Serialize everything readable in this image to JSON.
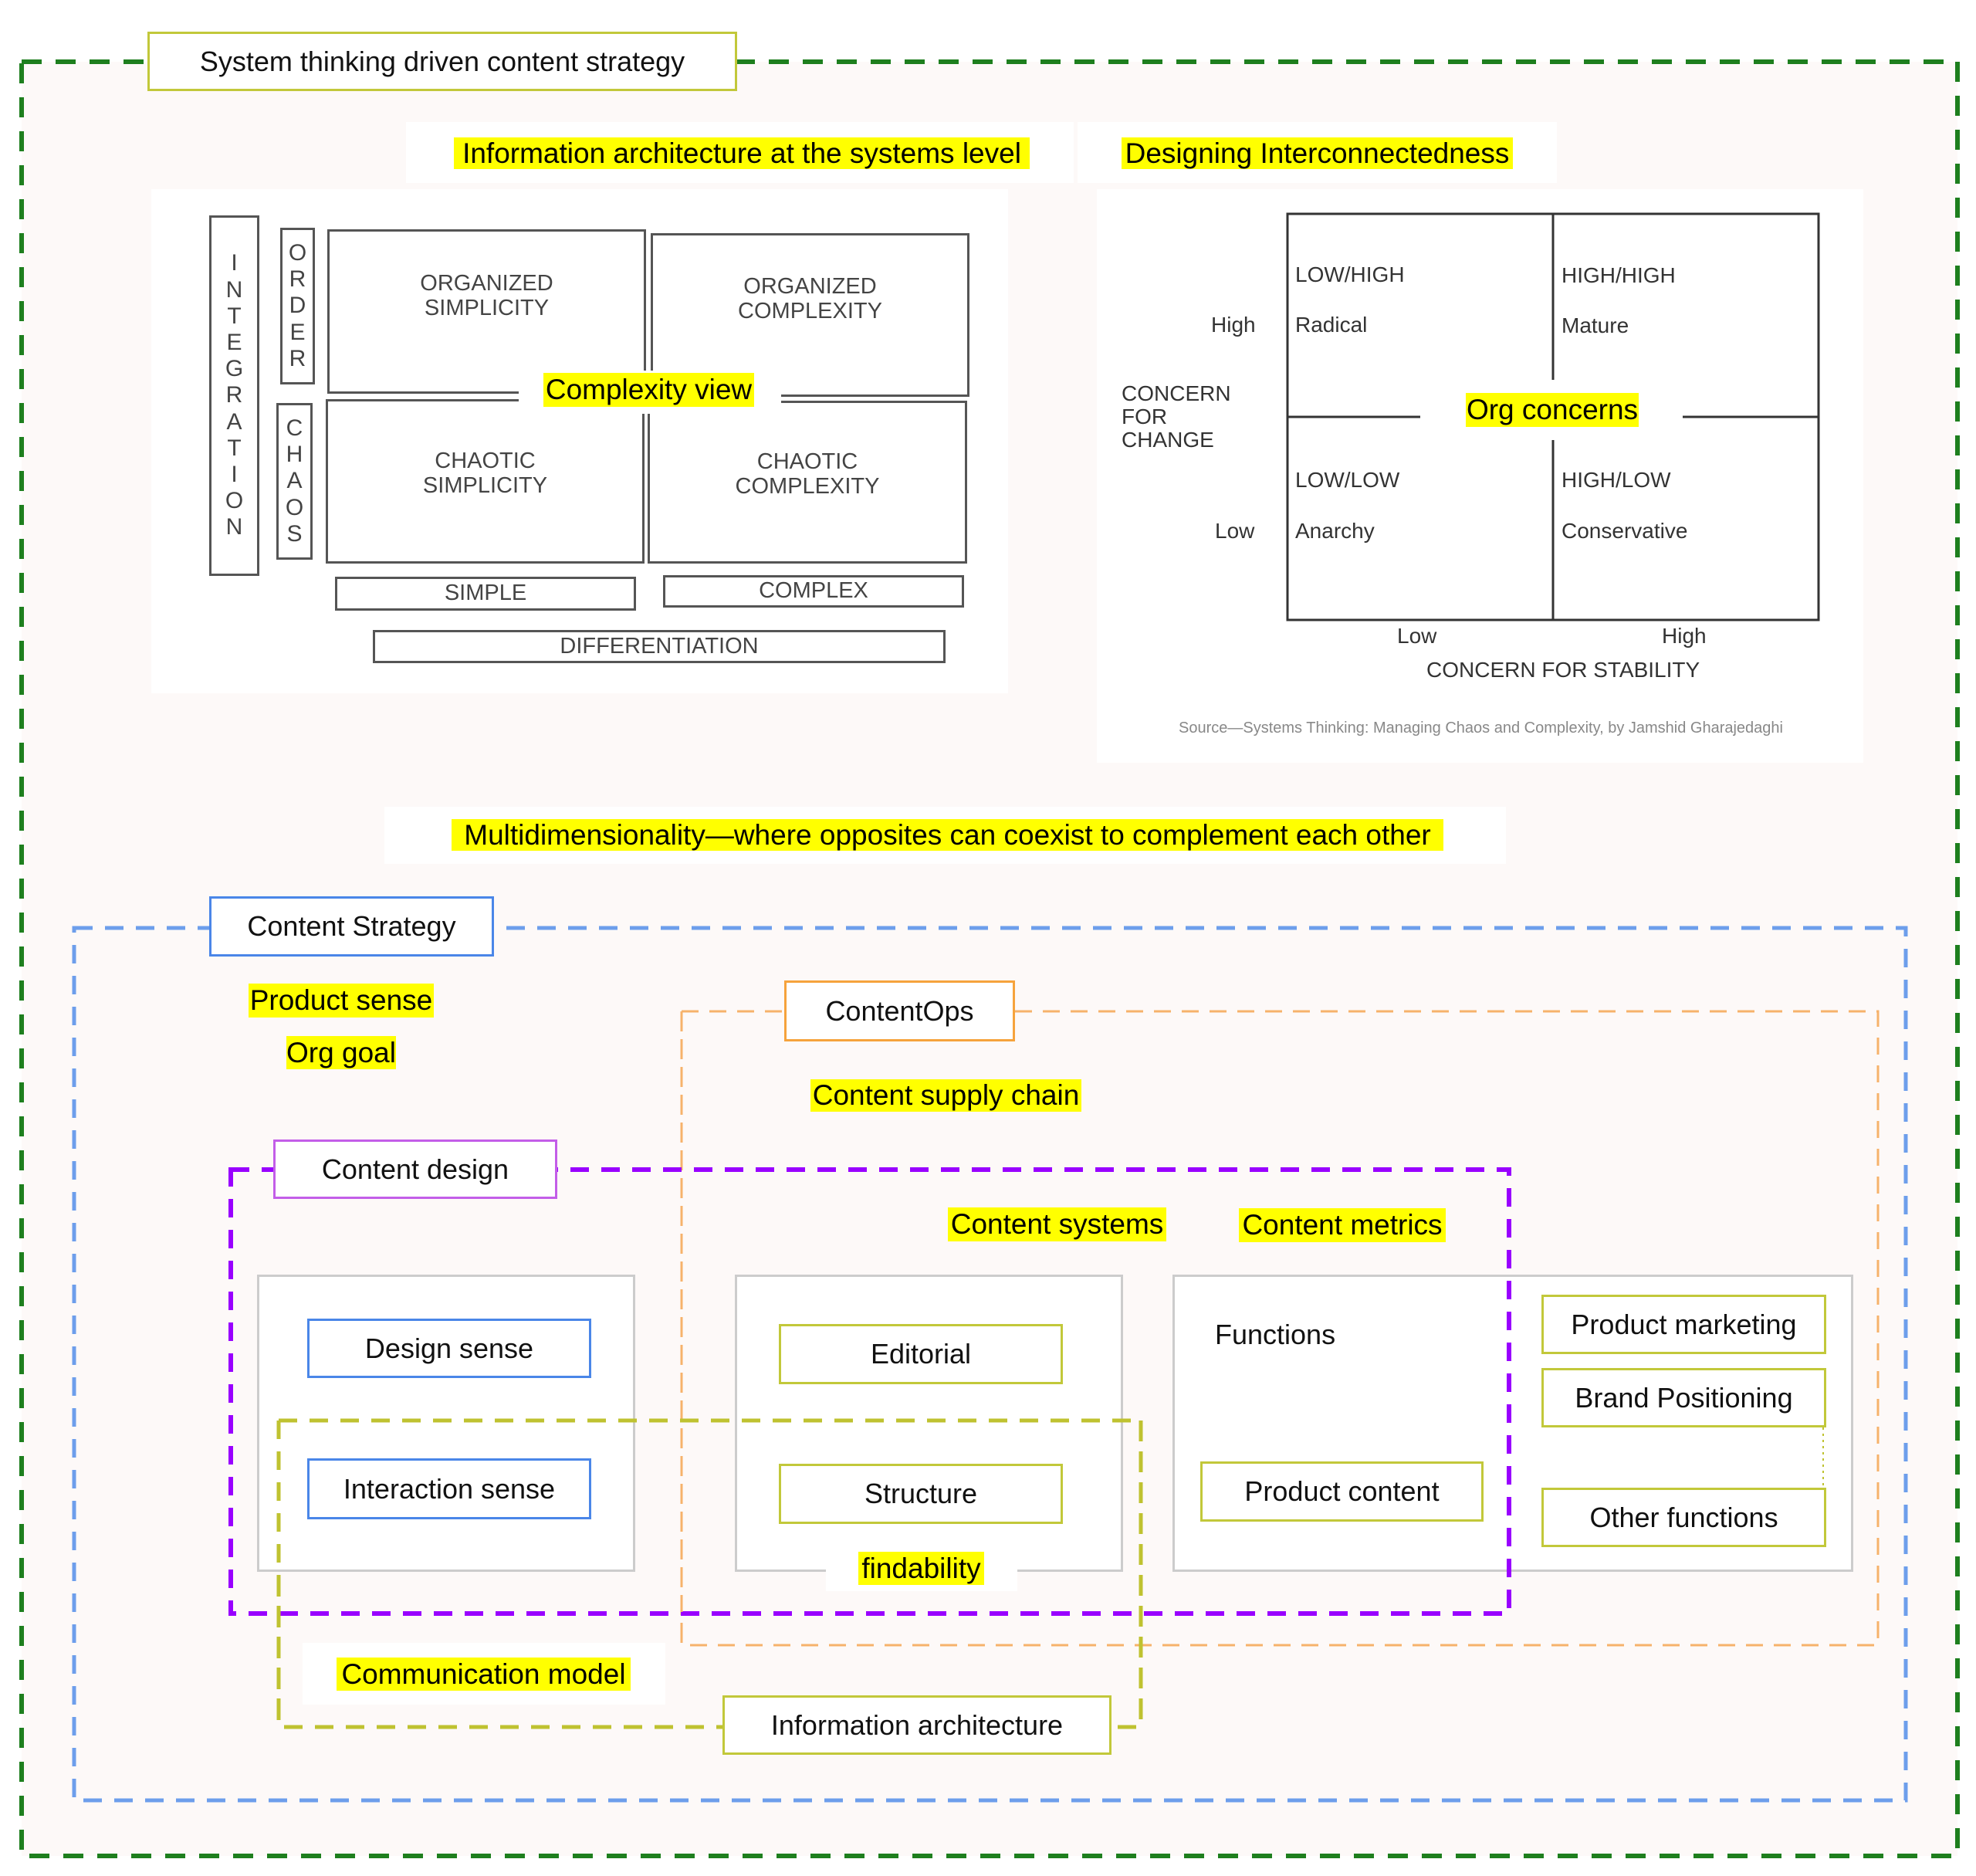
{
  "title": "System thinking driven content strategy",
  "sections": {
    "ia_systems_level": "Information architecture at the systems level",
    "designing_interconnectedness": "Designing Interconnectedness",
    "multidimensionality": "Multidimensionality—where opposites can coexist to complement each other"
  },
  "complexity_view": {
    "label": "Complexity view",
    "integration": "INTEGRATION",
    "order": "ORDER",
    "chaos": "CHAOS",
    "quadrants": {
      "organized_simplicity": [
        "ORGANIZED",
        "SIMPLICITY"
      ],
      "organized_complexity": [
        "ORGANIZED",
        "COMPLEXITY"
      ],
      "chaotic_simplicity": [
        "CHAOTIC",
        "SIMPLICITY"
      ],
      "chaotic_complexity": [
        "CHAOTIC",
        "COMPLEXITY"
      ]
    },
    "simple": "SIMPLE",
    "complex": "COMPLEX",
    "differentiation": "DIFFERENTIATION"
  },
  "org_concerns": {
    "label": "Org concerns",
    "y_axis_title": [
      "CONCERN",
      "FOR",
      "CHANGE"
    ],
    "y_high": "High",
    "y_low": "Low",
    "x_low": "Low",
    "x_high": "High",
    "x_axis_title": "CONCERN FOR STABILITY",
    "quadrants": {
      "top_left": {
        "code": "LOW/HIGH",
        "name": "Radical"
      },
      "top_right": {
        "code": "HIGH/HIGH",
        "name": "Mature"
      },
      "bottom_left": {
        "code": "LOW/LOW",
        "name": "Anarchy"
      },
      "bottom_right": {
        "code": "HIGH/LOW",
        "name": "Conservative"
      }
    },
    "source": "Source—Systems Thinking: Managing Chaos and Complexity, by Jamshid Gharajedaghi"
  },
  "content_strategy": {
    "label": "Content Strategy",
    "notes": [
      "Product sense",
      "Org goal"
    ]
  },
  "content_ops": {
    "label": "ContentOps",
    "note": "Content supply chain"
  },
  "content_design": {
    "label": "Content design",
    "notes": [
      "Content systems",
      "Content metrics"
    ]
  },
  "design_group": {
    "items": [
      "Design sense",
      "Interaction sense"
    ]
  },
  "editorial_group": {
    "items": [
      "Editorial",
      "Structure"
    ],
    "note": "findability"
  },
  "functions_group": {
    "label": "Functions",
    "product_content": "Product content",
    "items": [
      "Product marketing",
      "Brand Positioning",
      "Other functions"
    ]
  },
  "information_architecture": {
    "label": "Information architecture",
    "note": "Communication model"
  },
  "colors": {
    "outer_border": "#1e7f1e",
    "content_strategy": "#6d9eeb",
    "content_ops": "#f6b26b",
    "content_design": "#9900ff",
    "information_architecture": "#bfc230",
    "highlight": "#ffff00"
  }
}
